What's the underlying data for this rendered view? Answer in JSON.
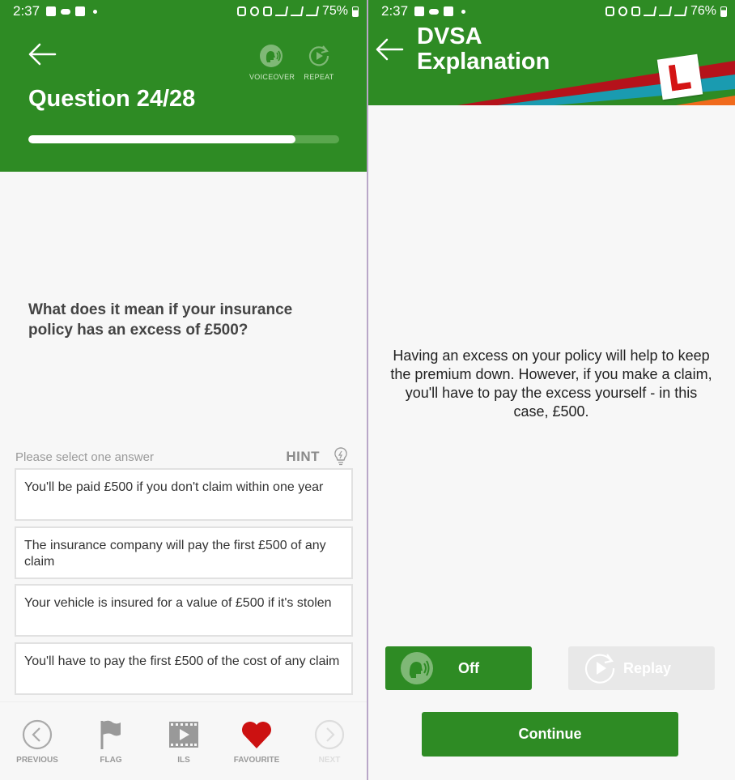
{
  "left_screen": {
    "status_bar": {
      "time": "2:37",
      "battery": "75%"
    },
    "header": {
      "title": "Question 24/28",
      "voiceover_label": "VOICEOVER",
      "repeat_label": "REPEAT",
      "progress_fraction": 0.86
    },
    "question": "What does it mean if your insurance policy has an excess of £500?",
    "instruction": "Please select one answer",
    "hint_label": "HINT",
    "answers": [
      "You'll be paid £500 if you don't claim within one year",
      "The insurance company will pay the first £500 of any claim",
      "Your vehicle is insured for a value of £500 if it's stolen",
      "You'll have to pay the first £500 of the cost of any claim"
    ],
    "bottom_nav": {
      "previous": "PREVIOUS",
      "flag": "FLAG",
      "ils": "ILS",
      "favourite": "FAVOURITE",
      "next": "NEXT"
    }
  },
  "right_screen": {
    "status_bar": {
      "time": "2:37",
      "battery": "76%"
    },
    "header": {
      "title_line1": "DVSA",
      "title_line2": "Explanation"
    },
    "explanation": "Having an excess on your policy will help to keep the premium down. However, if you make a claim, you'll have to pay the excess yourself - in this case, £500.",
    "voiceover_toggle_label": "Off",
    "replay_label": "Replay",
    "continue_label": "Continue"
  },
  "colors": {
    "brand_green": "#2e8b24",
    "favourite_red": "#cc1111",
    "stripe_red": "#b5121b",
    "stripe_teal": "#1a9bb0",
    "stripe_orange": "#f06a1c"
  }
}
